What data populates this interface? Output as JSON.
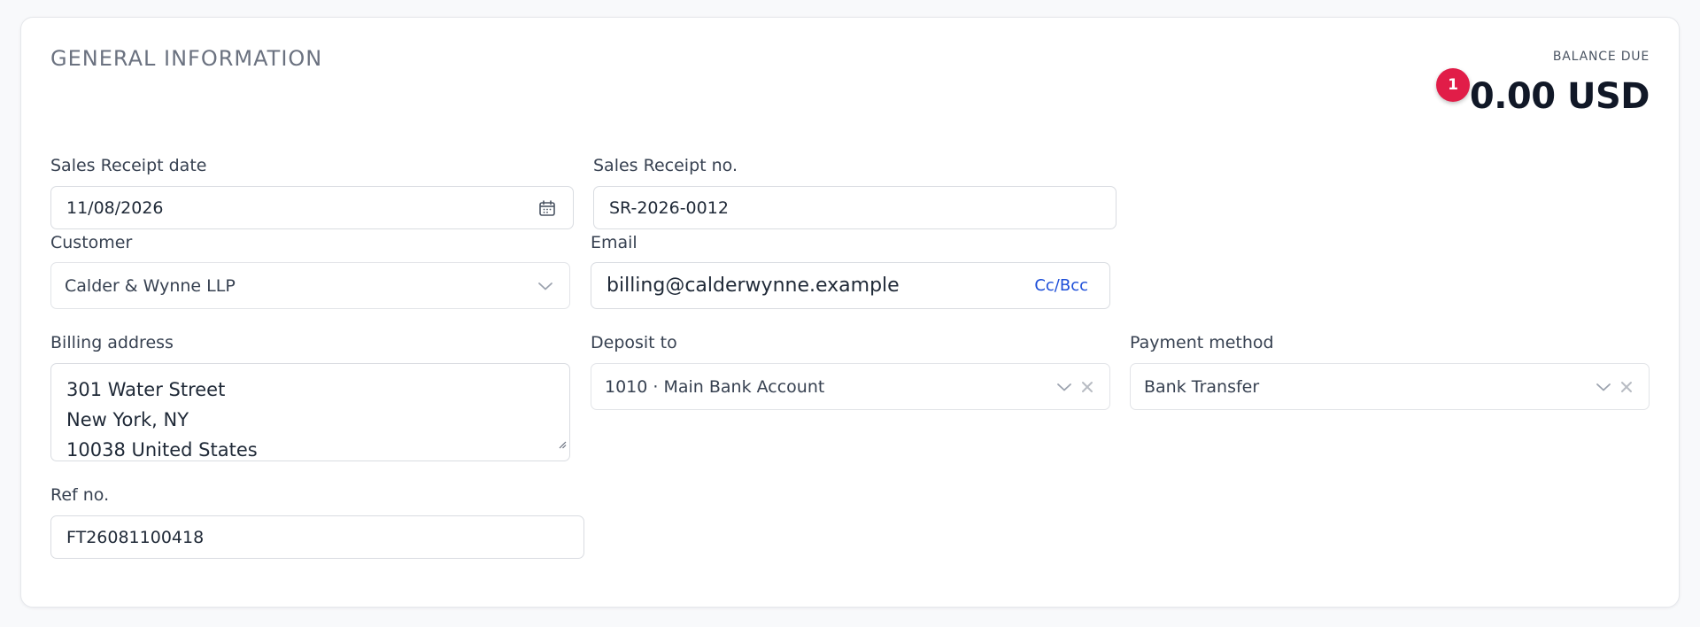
{
  "section": {
    "title": "GENERAL INFORMATION"
  },
  "balance": {
    "label": "BALANCE DUE",
    "value": "0.00 USD",
    "badge_count": "1"
  },
  "fields": {
    "receipt_date": {
      "label": "Sales Receipt date",
      "value": "11/08/2026"
    },
    "receipt_no": {
      "label": "Sales Receipt no.",
      "value": "SR-2026-0012"
    },
    "customer": {
      "label": "Customer",
      "value": "Calder & Wynne LLP"
    },
    "email": {
      "label": "Email",
      "value": "billing@calderwynne.example",
      "cc_label": "Cc/Bcc"
    },
    "billing_address": {
      "label": "Billing address",
      "lines": [
        "301 Water Street",
        "New York, NY",
        "10038 United States"
      ]
    },
    "deposit_to": {
      "label": "Deposit to",
      "value": "1010 · Main Bank Account"
    },
    "payment_method": {
      "label": "Payment method",
      "value": "Bank Transfer"
    },
    "ref_no": {
      "label": "Ref no.",
      "value": "FT26081100418"
    }
  },
  "icons": {
    "calendar": "calendar-icon",
    "chevron": "chevron-down-icon",
    "clear": "close-icon",
    "resize": "resize-handle-icon"
  },
  "colors": {
    "accent_link": "#1d4ed8",
    "badge": "#e11d48",
    "border": "#d9dce1",
    "title": "#6b7280"
  }
}
